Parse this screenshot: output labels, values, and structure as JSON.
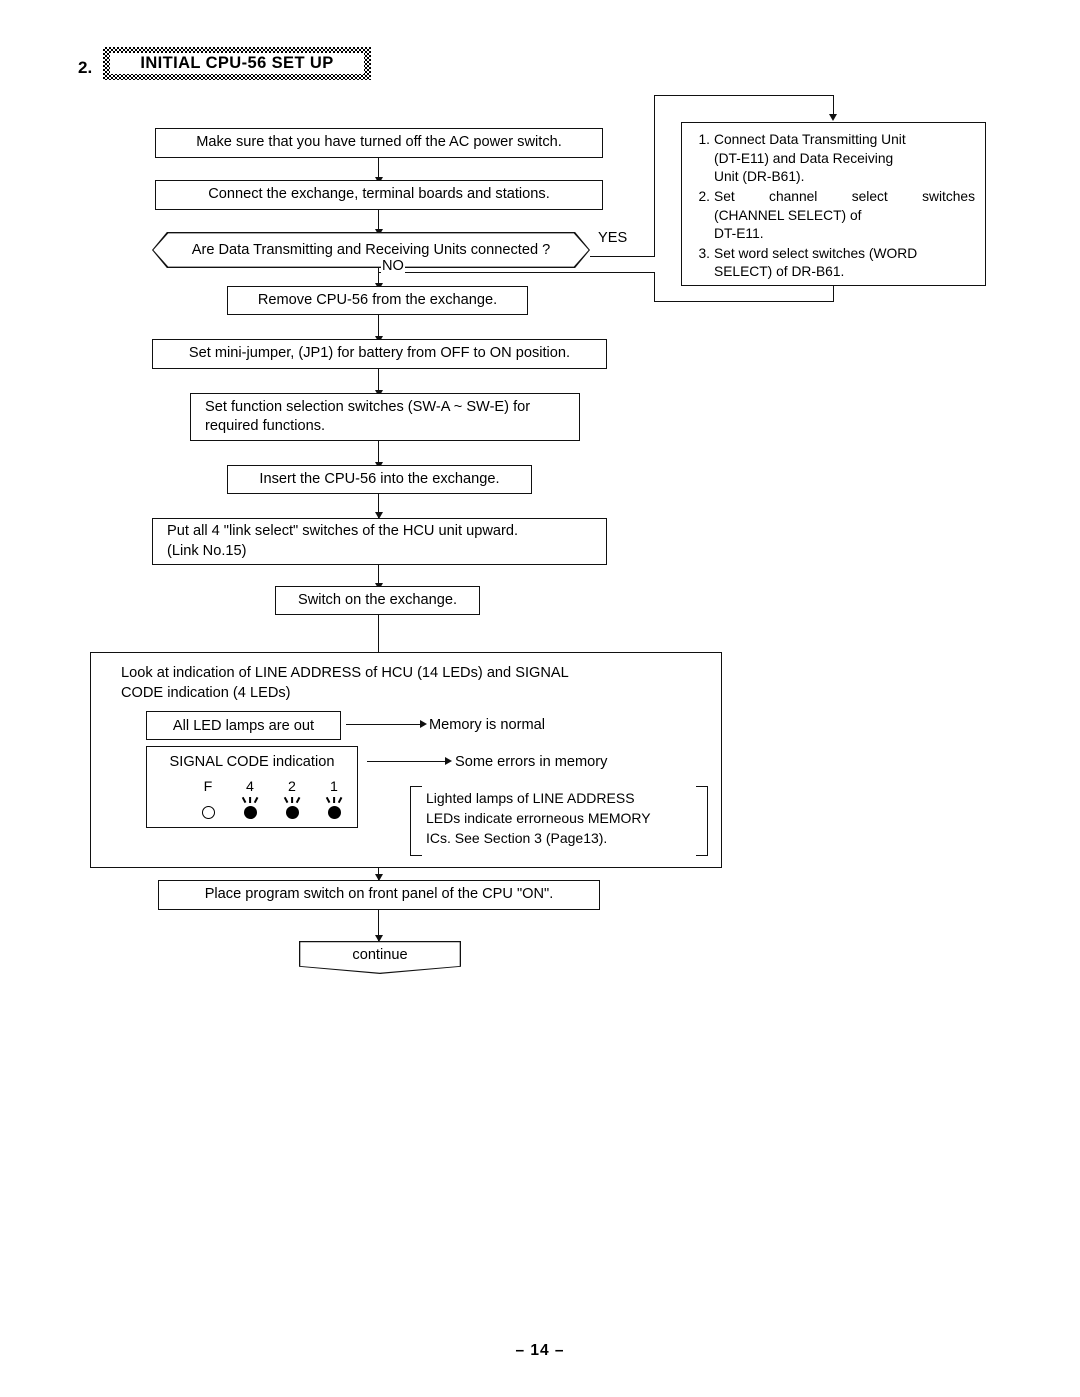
{
  "section": {
    "number": "2.",
    "title": "INITIAL  CPU-56  SET  UP"
  },
  "flow": {
    "step1": "Make sure that you have turned off the AC power switch.",
    "step2": "Connect the exchange, terminal boards and stations.",
    "decision": "Are Data Transmitting and Receiving Units connected ?",
    "label_yes": "YES",
    "label_no": "NO",
    "step3": "Remove CPU-56 from the exchange.",
    "step4": "Set mini-jumper, (JP1) for battery from OFF to ON position.",
    "step5_line1": "Set function selection switches (SW-A ~ SW-E) for",
    "step5_line2": "required functions.",
    "step6": "Insert the CPU-56 into the exchange.",
    "step7_line1": "Put all 4 \"link select\" switches of the HCU unit upward.",
    "step7_line2": "(Link No.15)",
    "step8": "Switch on the exchange.",
    "step9": "Place program switch on front panel of the CPU \"ON\".",
    "terminator": "continue"
  },
  "right_box": {
    "items": [
      {
        "num": "1.",
        "text": "Connect Data Transmitting Unit (DT-E11) and Data Receiving Unit (DR-B61)."
      },
      {
        "num": "2.",
        "text": "Set channel select switches (CHANNEL SELECT) of DT-E11."
      },
      {
        "num": "3.",
        "text": "Set word select switches (WORD SELECT) of DR-B61."
      }
    ],
    "item1_l1": "Connect Data Transmitting Unit",
    "item1_l2": "(DT-E11) and Data Receiving",
    "item1_l3": "Unit (DR-B61).",
    "item2_l1": "Set channel select switches",
    "item2_l2": "(CHANNEL SELECT) of",
    "item2_l3": "DT-E11.",
    "item3_l1": "Set word select switches (WORD",
    "item3_l2": "SELECT) of DR-B61."
  },
  "led_panel": {
    "heading_line1": "Look at indication of LINE ADDRESS of HCU (14 LEDs) and SIGNAL",
    "heading_line2": "CODE indication (4 LEDs)",
    "all_out_label": "All  LED lamps are out",
    "result_normal": "Memory is normal",
    "signal_code_label": "SIGNAL CODE indication",
    "result_error": "Some errors in memory",
    "leds": [
      {
        "label": "F",
        "lit": false
      },
      {
        "label": "4",
        "lit": true
      },
      {
        "label": "2",
        "lit": true
      },
      {
        "label": "1",
        "lit": true
      }
    ],
    "note_line1": "Lighted  lamps  of  LINE ADDRESS",
    "note_line2": "LEDs indicate errorneous  MEMORY",
    "note_line3": "ICs. See Section 3 (Page13)."
  },
  "footer": {
    "page": "–  14 –"
  }
}
